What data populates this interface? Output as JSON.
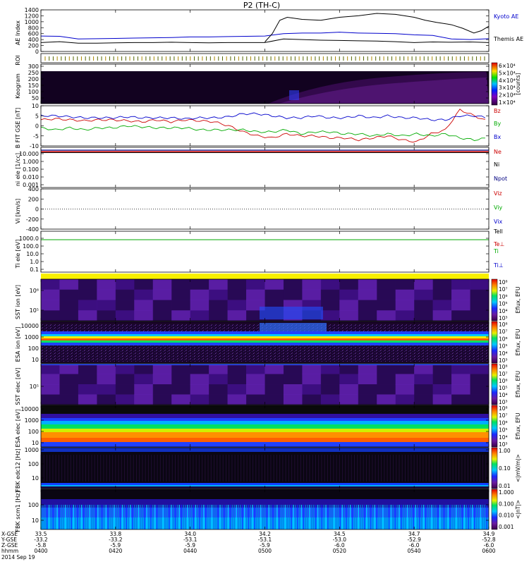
{
  "title": "P2 (TH-C)",
  "x_labels": {
    "rows": [
      "X-GSE",
      "Y-GSE",
      "Z-GSE",
      "hhmm"
    ],
    "date": "2014 Sep 19",
    "ticks": [
      {
        "x": "33.5",
        "y": "-33.2",
        "z": "-5.8",
        "t": "0400"
      },
      {
        "x": "33.8",
        "y": "-33.2",
        "z": "-5.9",
        "t": "0420"
      },
      {
        "x": "34.0",
        "y": "-53.1",
        "z": "-5.9",
        "t": "0440"
      },
      {
        "x": "34.2",
        "y": "-53.1",
        "z": "-5.9",
        "t": "0500"
      },
      {
        "x": "34.5",
        "y": "-53.0",
        "z": "-6.0",
        "t": "0520"
      },
      {
        "x": "34.7",
        "y": "-52.9",
        "z": "-6.0",
        "t": "0540"
      },
      {
        "x": "34.9",
        "y": "-52.8",
        "z": "-6.0",
        "t": "0600"
      }
    ]
  },
  "colors": {
    "kyoto": "#0000cc",
    "themis": "#000000",
    "bz": "#cc0000",
    "by": "#00aa00",
    "bx": "#0000cc",
    "ne": "#cc0000",
    "ni": "#000000",
    "npot": "#000080",
    "tell": "#000000",
    "teperp": "#cc0000",
    "ti": "#00aa00",
    "tiperp": "#0000cc"
  },
  "chart_data": [
    {
      "type": "line",
      "panel": "ae",
      "ylabel": "AE Index",
      "ylim": [
        0,
        1400
      ],
      "yticks": [
        "0",
        "200",
        "400",
        "600",
        "800",
        "1000",
        "1200",
        "1400"
      ],
      "x": [
        0,
        5,
        10,
        15,
        20,
        25,
        30,
        35,
        40,
        45,
        50,
        55,
        60,
        65,
        70,
        75,
        80,
        85,
        90,
        95,
        100,
        105,
        110,
        115,
        120
      ],
      "series": [
        {
          "name": "Kyoto AE",
          "values": [
            520,
            510,
            420,
            430,
            440,
            450,
            460,
            470,
            490,
            490,
            500,
            510,
            520,
            600,
            620,
            620,
            650,
            620,
            610,
            600,
            560,
            540,
            420,
            400,
            430
          ]
        },
        {
          "name": "Themis AE",
          "values": [
            300,
            330,
            280,
            280,
            290,
            300,
            300,
            310,
            300,
            290,
            300,
            300,
            300,
            420,
            400,
            380,
            370,
            360,
            350,
            330,
            300,
            320,
            310,
            320,
            300
          ]
        }
      ],
      "themis_spike": {
        "x": [
          60,
          62,
          64,
          66,
          70,
          75,
          80,
          85,
          90,
          95,
          100,
          103,
          106,
          110,
          113,
          116,
          118,
          120
        ],
        "y": [
          320,
          600,
          1050,
          1150,
          1080,
          1050,
          1150,
          1200,
          1280,
          1250,
          1150,
          1050,
          980,
          900,
          780,
          620,
          700,
          850
        ]
      }
    },
    {
      "type": "heatmap",
      "panel": "roi",
      "ylabel": "ROI"
    },
    {
      "type": "heatmap",
      "panel": "keogram",
      "ylabel": "Keogram",
      "yticks": [
        "50",
        "100",
        "150",
        "200",
        "250",
        "300"
      ],
      "colorbar": {
        "ticks": [
          "6×10⁴",
          "5×10⁴",
          "4×10⁴",
          "3×10⁴",
          "2×10⁴",
          "1×10⁴"
        ],
        "label": "[counts]"
      }
    },
    {
      "type": "line",
      "panel": "bfield",
      "ylabel": "B FIT GSE [nT]",
      "ylim": [
        -10,
        10
      ],
      "yticks": [
        "-10",
        "-5",
        "0",
        "5",
        "10"
      ],
      "series": [
        {
          "name": "Bz",
          "values": [
            3,
            3.5,
            3,
            2.5,
            3,
            3,
            2.5,
            2,
            3,
            2,
            3,
            2.5,
            2,
            0,
            -3,
            -5,
            -6,
            -4,
            -5,
            -5,
            -6,
            -6,
            -7,
            -6,
            -5,
            -7,
            -8,
            -4,
            -2,
            8,
            5,
            2
          ]
        },
        {
          "name": "By",
          "values": [
            -1,
            -2,
            -1,
            -2,
            -1,
            -1,
            0,
            -0.5,
            -1,
            -1,
            -1,
            -2,
            -2,
            -2,
            -2,
            -3,
            -3,
            -2,
            -4,
            -3,
            -3,
            -4,
            -4,
            -5,
            -4,
            -5,
            -4,
            -5,
            -4,
            -6,
            -7,
            -6
          ]
        },
        {
          "name": "Bx",
          "values": [
            5,
            5,
            4.5,
            4,
            4,
            4,
            4.5,
            4,
            4,
            4,
            3.5,
            4,
            4,
            4.5,
            6,
            6,
            5,
            4,
            4,
            5,
            4,
            4,
            5,
            4,
            5,
            4,
            4,
            3,
            3,
            5,
            5,
            4
          ]
        }
      ]
    },
    {
      "type": "line",
      "panel": "density",
      "ylabel": "ni ele [1/cc]",
      "scale": "log",
      "yticks": [
        "0.001",
        "0.010",
        "0.100",
        "1.000",
        "10.000"
      ],
      "series": [
        {
          "name": "Ne"
        },
        {
          "name": "Ni"
        },
        {
          "name": "Npot"
        }
      ]
    },
    {
      "type": "line",
      "panel": "velocity",
      "ylabel": "Vi [km/s]",
      "ylim": [
        -400,
        400
      ],
      "yticks": [
        "-400",
        "-200",
        "0",
        "200",
        "400"
      ],
      "series": [
        {
          "name": "Viz"
        },
        {
          "name": "Viy"
        },
        {
          "name": "Vix"
        }
      ]
    },
    {
      "type": "line",
      "panel": "temperature",
      "ylabel": "Ti ele [eV]",
      "scale": "log",
      "yticks": [
        "0.1",
        "1.0",
        "10.0",
        "100.0",
        "1000.0"
      ],
      "series": [
        {
          "name": "Tell"
        },
        {
          "name": "Te⊥"
        },
        {
          "name": "Ti"
        },
        {
          "name": "Ti⊥"
        }
      ]
    },
    {
      "type": "heatmap",
      "panel": "sst_i",
      "ylabel": "SST ion [eV]",
      "yticks": [
        "10⁶",
        "10⁵"
      ],
      "colorbar": {
        "ticks": [
          "10⁸",
          "10⁷",
          "10⁶",
          "10⁵",
          "10⁴",
          "10³"
        ],
        "label": "Eflux, EFU"
      }
    },
    {
      "type": "heatmap",
      "panel": "esa_i",
      "ylabel": "ESA ion [eV]",
      "yticks": [
        "10000",
        "1000",
        "100",
        "10"
      ],
      "colorbar": {
        "ticks": [
          "10⁸",
          "10⁷",
          "10⁶",
          "10⁵",
          "10⁴",
          "10³"
        ],
        "label": "Eflux, EFU"
      }
    },
    {
      "type": "heatmap",
      "panel": "sst_e",
      "ylabel": "SST elec [eV]",
      "yticks": [
        "10⁵"
      ],
      "colorbar": {
        "ticks": [
          "10⁸",
          "10⁷",
          "10⁶",
          "10⁵",
          "10⁴",
          "10³"
        ],
        "label": "Eflux, EFU"
      }
    },
    {
      "type": "heatmap",
      "panel": "esa_e",
      "ylabel": "ESA elec [eV]",
      "yticks": [
        "10000",
        "1000",
        "100",
        "10"
      ],
      "colorbar": {
        "ticks": [
          "10⁸",
          "10⁷",
          "10⁶",
          "10⁵",
          "10⁴",
          "10³"
        ],
        "label": "Eflux, EFU"
      }
    },
    {
      "type": "heatmap",
      "panel": "fbk_e",
      "ylabel": "FBK edc12 [Hz]",
      "yticks": [
        "1000",
        "100",
        "10"
      ],
      "colorbar": {
        "ticks": [
          "1.00",
          "0.10",
          "0.01"
        ],
        "label": "<|mV/m|>"
      }
    },
    {
      "type": "heatmap",
      "panel": "fbk_b",
      "ylabel": "FBK scm1 [Hz]",
      "yticks": [
        "100",
        "10"
      ],
      "colorbar": {
        "ticks": [
          "1.000",
          "0.100",
          "0.010",
          "0.001"
        ],
        "label": "<|nT|>"
      }
    }
  ]
}
